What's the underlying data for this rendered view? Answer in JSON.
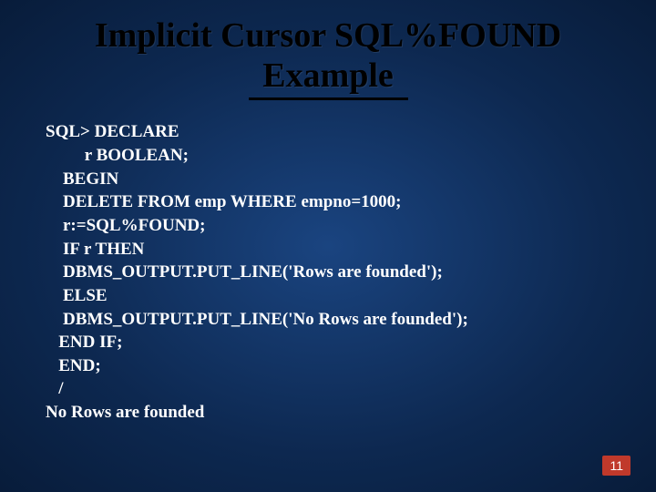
{
  "slide": {
    "title_line1": "Implicit Cursor SQL%FOUND",
    "title_line2": "Example",
    "code": "SQL> DECLARE\n         r BOOLEAN;\n    BEGIN\n    DELETE FROM emp WHERE empno=1000;\n    r:=SQL%FOUND;\n    IF r THEN\n    DBMS_OUTPUT.PUT_LINE('Rows are founded');\n    ELSE\n    DBMS_OUTPUT.PUT_LINE('No Rows are founded');\n   END IF;\n   END;\n   /\nNo Rows are founded",
    "page_number": "11"
  }
}
